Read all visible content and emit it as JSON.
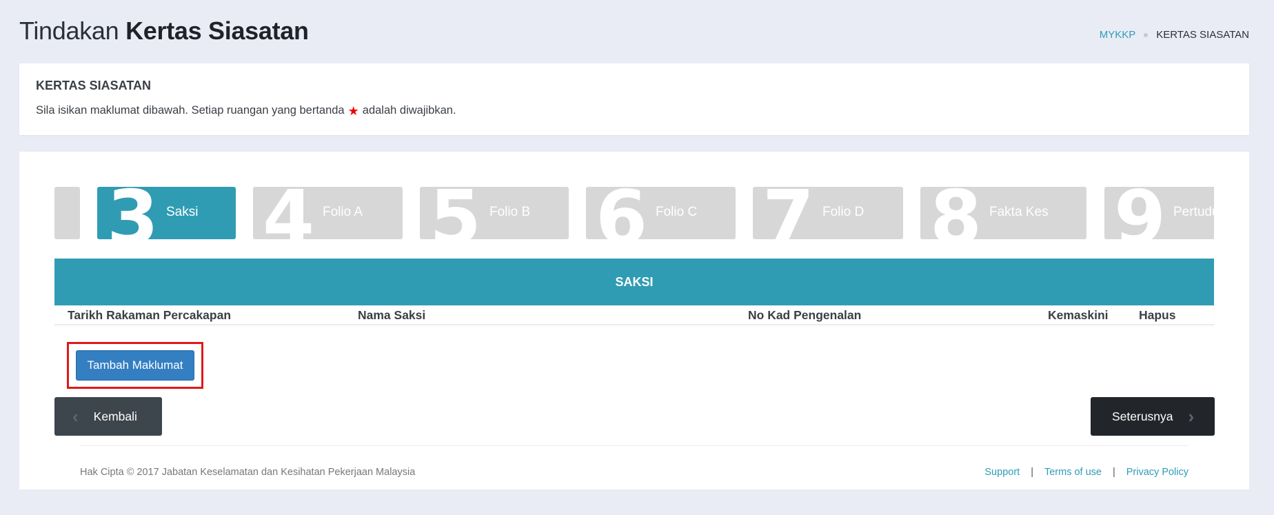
{
  "header": {
    "title_light": "Tindakan",
    "title_bold": "Kertas Siasatan",
    "breadcrumb": {
      "home": "MYKKP",
      "current": "KERTAS SIASATAN"
    }
  },
  "info": {
    "heading": "KERTAS SIASATAN",
    "desc_before": "Sila isikan maklumat dibawah. Setiap ruangan yang bertanda",
    "desc_after": "adalah diwajibkan.",
    "star_icon": "★"
  },
  "steps": [
    {
      "num": "",
      "label": ""
    },
    {
      "num": "3",
      "label": "Saksi",
      "active": true
    },
    {
      "num": "4",
      "label": "Folio A"
    },
    {
      "num": "5",
      "label": "Folio B"
    },
    {
      "num": "6",
      "label": "Folio C"
    },
    {
      "num": "7",
      "label": "Folio D"
    },
    {
      "num": "8",
      "label": "Fakta Kes"
    },
    {
      "num": "9",
      "label": "Pertuduhan"
    }
  ],
  "table": {
    "title": "SAKSI",
    "columns": [
      "Tarikh Rakaman Percakapan",
      "Nama Saksi",
      "No Kad Pengenalan",
      "Kemaskini",
      "Hapus"
    ],
    "rows": []
  },
  "actions": {
    "add_label": "Tambah Maklumat",
    "back_label": "Kembali",
    "next_label": "Seterusnya",
    "chevron_left": "‹",
    "chevron_right": "›"
  },
  "footer": {
    "copyright": "Hak Cipta © 2017 Jabatan Keselamatan dan Kesihatan Pekerjaan Malaysia",
    "links": [
      "Support",
      "Terms of use",
      "Privacy Policy"
    ],
    "separator": "|"
  },
  "colors": {
    "accent": "#2f9cb3",
    "primary_button": "#347ec2",
    "highlight": "#e01919",
    "inactive_step": "#d7d7d7"
  }
}
